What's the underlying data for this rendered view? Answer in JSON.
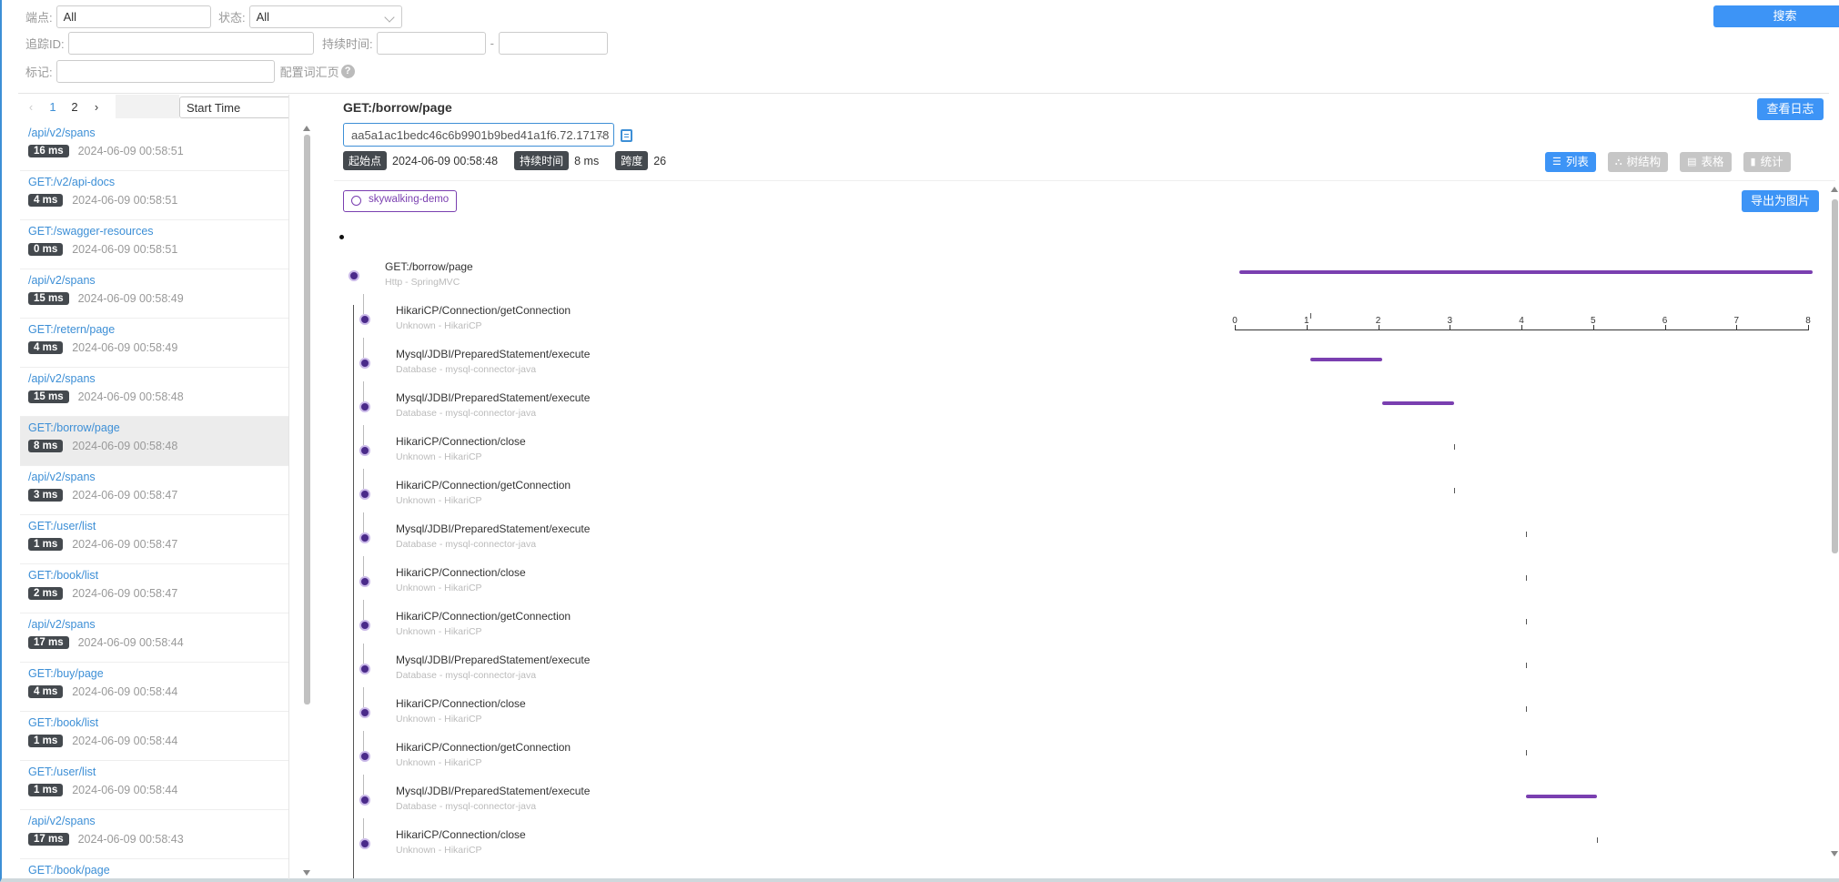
{
  "filters": {
    "endpoint_label": "端点:",
    "endpoint_value": "All",
    "status_label": "状态:",
    "status_value": "All",
    "trace_id_label": "追踪ID:",
    "trace_id_value": "",
    "duration_label": "持续时间:",
    "duration_min": "",
    "duration_sep": "-",
    "duration_max": "",
    "tags_label": "标记:",
    "tags_value": "",
    "config_label": "配置词汇页",
    "help_icon": "?",
    "search_label": "搜索"
  },
  "pager": {
    "prev": "‹",
    "pages": [
      "1",
      "2"
    ],
    "next": "›",
    "sort_value": "Start Time"
  },
  "traces": [
    {
      "name": "/api/v2/spans",
      "duration": "16 ms",
      "time": "2024-06-09 00:58:51"
    },
    {
      "name": "GET:/v2/api-docs",
      "duration": "4 ms",
      "time": "2024-06-09 00:58:51"
    },
    {
      "name": "GET:/swagger-resources",
      "duration": "0 ms",
      "time": "2024-06-09 00:58:51"
    },
    {
      "name": "/api/v2/spans",
      "duration": "15 ms",
      "time": "2024-06-09 00:58:49"
    },
    {
      "name": "GET:/retern/page",
      "duration": "4 ms",
      "time": "2024-06-09 00:58:49"
    },
    {
      "name": "/api/v2/spans",
      "duration": "15 ms",
      "time": "2024-06-09 00:58:48"
    },
    {
      "name": "GET:/borrow/page",
      "duration": "8 ms",
      "time": "2024-06-09 00:58:48"
    },
    {
      "name": "/api/v2/spans",
      "duration": "3 ms",
      "time": "2024-06-09 00:58:47"
    },
    {
      "name": "GET:/user/list",
      "duration": "1 ms",
      "time": "2024-06-09 00:58:47"
    },
    {
      "name": "GET:/book/list",
      "duration": "2 ms",
      "time": "2024-06-09 00:58:47"
    },
    {
      "name": "/api/v2/spans",
      "duration": "17 ms",
      "time": "2024-06-09 00:58:44"
    },
    {
      "name": "GET:/buy/page",
      "duration": "4 ms",
      "time": "2024-06-09 00:58:44"
    },
    {
      "name": "GET:/book/list",
      "duration": "1 ms",
      "time": "2024-06-09 00:58:44"
    },
    {
      "name": "GET:/user/list",
      "duration": "1 ms",
      "time": "2024-06-09 00:58:44"
    },
    {
      "name": "/api/v2/spans",
      "duration": "17 ms",
      "time": "2024-06-09 00:58:43"
    },
    {
      "name": "GET:/book/page",
      "duration": "",
      "time": ""
    }
  ],
  "selected_index": 6,
  "detail": {
    "title": "GET:/borrow/page",
    "view_logs": "查看日志",
    "trace_id": "aa5a1ac1bedc46c6b9901b9bed41a1f6.72.17178",
    "start_label": "起始点",
    "start_value": "2024-06-09 00:58:48",
    "duration_label": "持续时间",
    "duration_value": "8 ms",
    "spans_label": "跨度",
    "spans_value": "26",
    "views": [
      {
        "label": "列表",
        "icon": "list-icon",
        "glyph": "☰",
        "active": true
      },
      {
        "label": "树结构",
        "icon": "tree-icon",
        "glyph": "⛬",
        "active": false
      },
      {
        "label": "表格",
        "icon": "table-icon",
        "glyph": "▤",
        "active": false
      },
      {
        "label": "统计",
        "icon": "stats-icon",
        "glyph": "▮",
        "active": false
      }
    ],
    "service": "skywalking-demo",
    "export": "导出为图片",
    "axis_ticks": [
      "0",
      "1",
      "2",
      "3",
      "4",
      "5",
      "6",
      "7",
      "8"
    ],
    "accent_color": "#7a3fb0",
    "spans": [
      {
        "name": "GET:/borrow/page",
        "desc": "Http - SpringMVC",
        "start": 0.06,
        "end": 8.06,
        "level": 0
      },
      {
        "name": "HikariCP/Connection/getConnection",
        "desc": "Unknown - HikariCP",
        "start": 1.06,
        "end": 1.06,
        "level": 1
      },
      {
        "name": "Mysql/JDBI/PreparedStatement/execute",
        "desc": "Database - mysql-connector-java",
        "start": 1.06,
        "end": 2.06,
        "level": 1
      },
      {
        "name": "Mysql/JDBI/PreparedStatement/execute",
        "desc": "Database - mysql-connector-java",
        "start": 2.06,
        "end": 3.06,
        "level": 1
      },
      {
        "name": "HikariCP/Connection/close",
        "desc": "Unknown - HikariCP",
        "start": 3.06,
        "end": 3.06,
        "level": 1
      },
      {
        "name": "HikariCP/Connection/getConnection",
        "desc": "Unknown - HikariCP",
        "start": 3.06,
        "end": 3.06,
        "level": 1
      },
      {
        "name": "Mysql/JDBI/PreparedStatement/execute",
        "desc": "Database - mysql-connector-java",
        "start": 4.06,
        "end": 4.06,
        "level": 1
      },
      {
        "name": "HikariCP/Connection/close",
        "desc": "Unknown - HikariCP",
        "start": 4.06,
        "end": 4.06,
        "level": 1
      },
      {
        "name": "HikariCP/Connection/getConnection",
        "desc": "Unknown - HikariCP",
        "start": 4.06,
        "end": 4.06,
        "level": 1
      },
      {
        "name": "Mysql/JDBI/PreparedStatement/execute",
        "desc": "Database - mysql-connector-java",
        "start": 4.06,
        "end": 4.06,
        "level": 1
      },
      {
        "name": "HikariCP/Connection/close",
        "desc": "Unknown - HikariCP",
        "start": 4.06,
        "end": 4.06,
        "level": 1
      },
      {
        "name": "HikariCP/Connection/getConnection",
        "desc": "Unknown - HikariCP",
        "start": 4.06,
        "end": 4.06,
        "level": 1
      },
      {
        "name": "Mysql/JDBI/PreparedStatement/execute",
        "desc": "Database - mysql-connector-java",
        "start": 4.06,
        "end": 5.06,
        "level": 1
      },
      {
        "name": "HikariCP/Connection/close",
        "desc": "Unknown - HikariCP",
        "start": 5.06,
        "end": 5.06,
        "level": 1
      }
    ]
  }
}
